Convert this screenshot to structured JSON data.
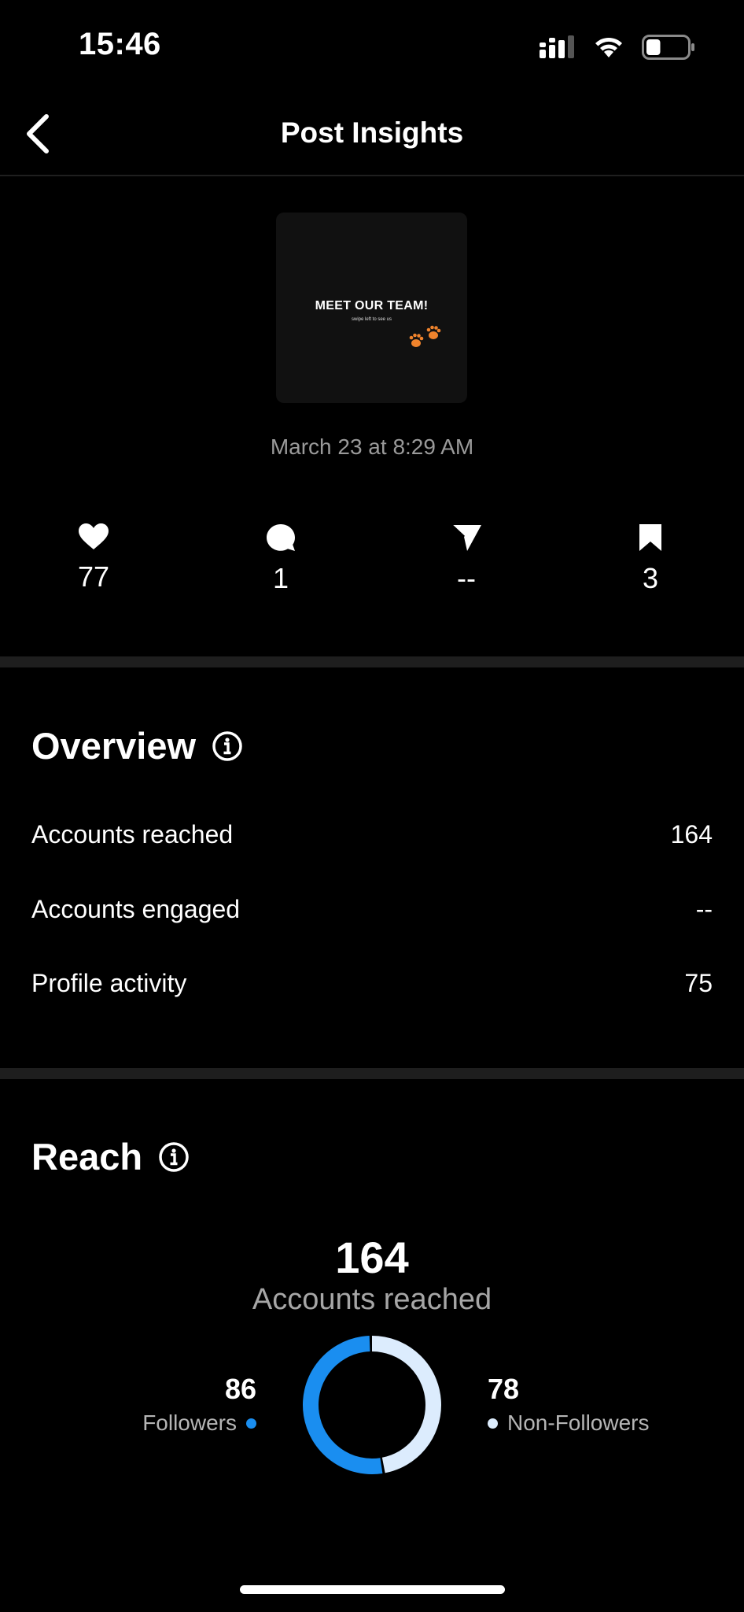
{
  "status_bar": {
    "time": "15:46",
    "battery_level": 0.35
  },
  "header": {
    "title": "Post Insights"
  },
  "post": {
    "thumbnail_title": "MEET OUR TEAM!",
    "thumbnail_subtitle": "swipe left to see us",
    "date": "March 23 at 8:29 AM"
  },
  "stats": {
    "likes": "77",
    "comments": "1",
    "shares": "--",
    "saves": "3"
  },
  "overview": {
    "title": "Overview",
    "rows": [
      {
        "label": "Accounts reached",
        "value": "164"
      },
      {
        "label": "Accounts engaged",
        "value": "--"
      },
      {
        "label": "Profile activity",
        "value": "75"
      }
    ]
  },
  "reach": {
    "title": "Reach",
    "total": "164",
    "total_label": "Accounts reached",
    "followers": {
      "value": "86",
      "label": "Followers",
      "color": "#1a8ef0"
    },
    "non_followers": {
      "value": "78",
      "label": "Non-Followers",
      "color": "#dcecfd"
    }
  },
  "colors": {
    "accent_blue": "#1a8ef0",
    "light_blue": "#dcecfd",
    "paw_orange": "#f0832c"
  }
}
